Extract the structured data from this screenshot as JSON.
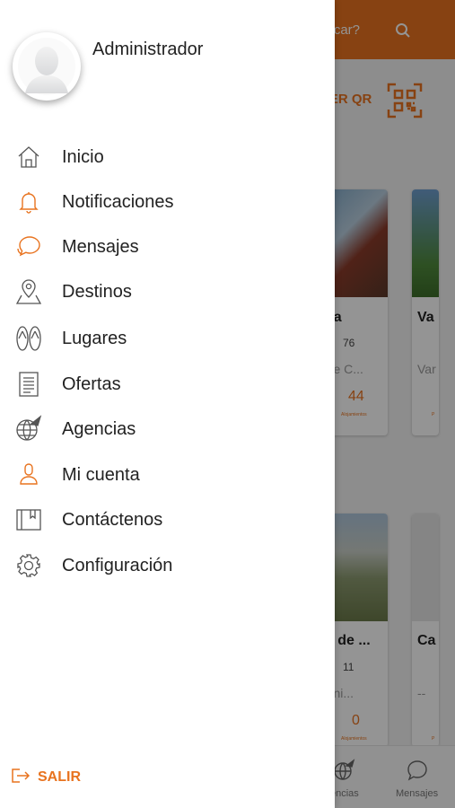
{
  "background": {
    "search_placeholder_partial": "uscar?",
    "qr_label_partial": "NER QR",
    "cards_row1": [
      {
        "title": "pa",
        "views": "76",
        "subtitle": "o de C...",
        "count": "44",
        "count_label": "Alojamientos"
      },
      {
        "title": "Va",
        "views": "",
        "subtitle": "Var",
        "count": "",
        "count_label": "P"
      }
    ],
    "cards_row2": [
      {
        "title": "o de ...",
        "views": "11",
        "subtitle": "Muni...",
        "count": "0",
        "count_label": "Alojamientos"
      },
      {
        "title": "Ca",
        "views": "",
        "subtitle": "--",
        "count": "",
        "count_label": "P"
      }
    ],
    "bottom_nav": [
      {
        "label": "encias",
        "icon": "globe-plane-icon"
      },
      {
        "label": "Mensajes",
        "icon": "chat-bubble-icon"
      }
    ]
  },
  "drawer": {
    "user_name": "Administrador",
    "menu": [
      {
        "label": "Inicio",
        "icon": "home-icon"
      },
      {
        "label": "Notificaciones",
        "icon": "bell-icon"
      },
      {
        "label": "Mensajes",
        "icon": "chat-bubble-icon"
      },
      {
        "label": "Destinos",
        "icon": "map-pin-icon"
      },
      {
        "label": "Lugares",
        "icon": "flip-flops-icon"
      },
      {
        "label": "Ofertas",
        "icon": "document-list-icon"
      },
      {
        "label": "Agencias",
        "icon": "globe-plane-icon"
      },
      {
        "label": "Mi cuenta",
        "icon": "user-icon"
      },
      {
        "label": "Contáctenos",
        "icon": "book-icon"
      },
      {
        "label": "Configuración",
        "icon": "gear-icon"
      }
    ],
    "logout_label": "SALIR"
  },
  "colors": {
    "accent": "#e8731f",
    "text": "#222222"
  }
}
